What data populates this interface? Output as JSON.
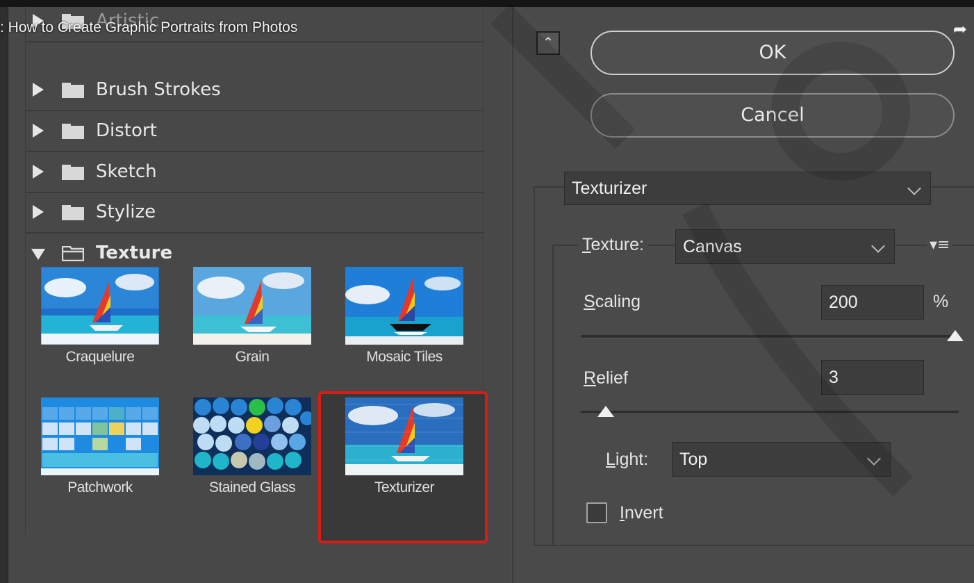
{
  "video": {
    "title": ": How to Create Graphic Portraits from Photos",
    "share_icon": "share-icon"
  },
  "categories": [
    {
      "label": "Artistic",
      "expanded": false
    },
    {
      "label": "Brush Strokes",
      "expanded": false
    },
    {
      "label": "Distort",
      "expanded": false
    },
    {
      "label": "Sketch",
      "expanded": false
    },
    {
      "label": "Stylize",
      "expanded": false
    },
    {
      "label": "Texture",
      "expanded": true
    }
  ],
  "filters": [
    {
      "label": "Craquelure"
    },
    {
      "label": "Grain"
    },
    {
      "label": "Mosaic Tiles"
    },
    {
      "label": "Patchwork"
    },
    {
      "label": "Stained Glass"
    },
    {
      "label": "Texturizer",
      "selected": true
    }
  ],
  "buttons": {
    "ok": "OK",
    "cancel": "Cancel"
  },
  "filter_select": {
    "value": "Texturizer"
  },
  "texture": {
    "label_u": "T",
    "label_rest": "exture:",
    "value": "Canvas",
    "scaling_u": "S",
    "scaling_rest": "caling",
    "scaling_value": "200",
    "scaling_unit": "%",
    "relief_u": "R",
    "relief_rest": "elief",
    "relief_value": "3",
    "light_u": "L",
    "light_rest": "ight:",
    "light_value": "Top",
    "invert_u": "I",
    "invert_rest": "nvert",
    "invert_checked": false
  },
  "colors": {
    "accent_red": "#d61e16",
    "panel": "#4a4a4a",
    "field": "#3d3d3d"
  }
}
